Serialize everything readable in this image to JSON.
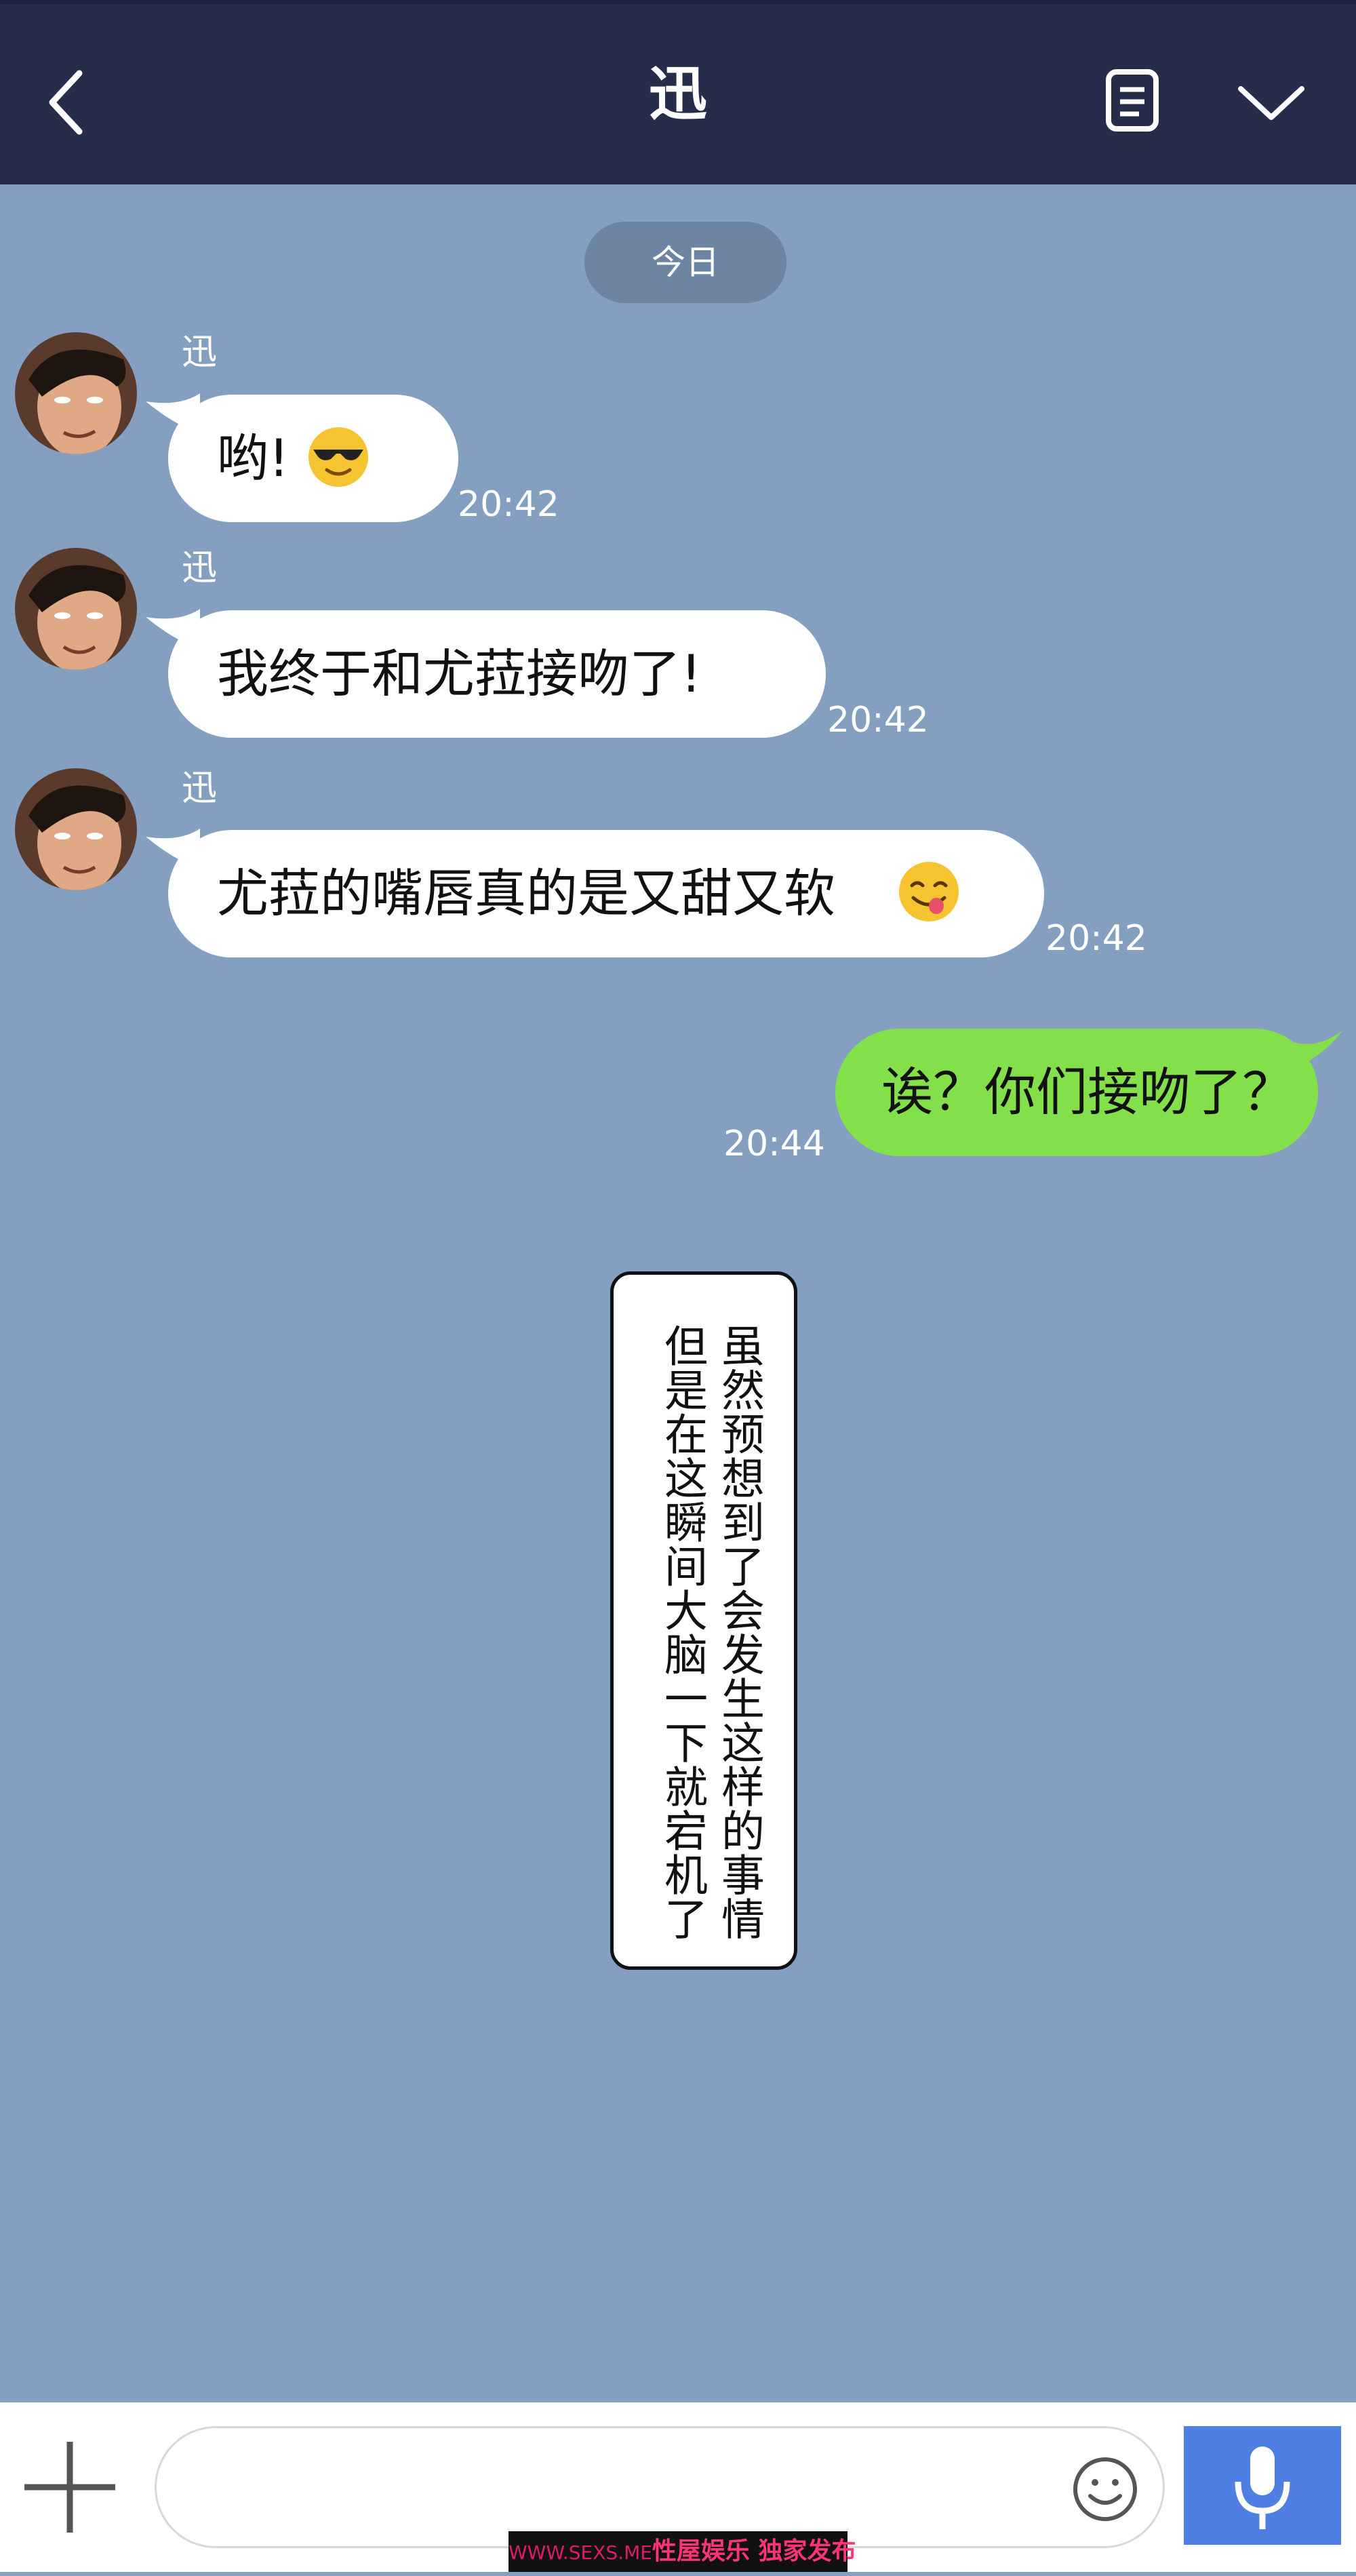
{
  "header": {
    "title": "迅"
  },
  "date_label": "今日",
  "messages": [
    {
      "sender": "迅",
      "text": "哟!",
      "emoji": "sunglasses-emoji",
      "time": "20:42"
    },
    {
      "sender": "迅",
      "text": "我终于和尤菈接吻了!",
      "time": "20:42"
    },
    {
      "sender": "迅",
      "text": "尤菈的嘴唇真的是又甜又软",
      "emoji": "yum-emoji",
      "time": "20:42"
    },
    {
      "sender": "me",
      "text": "诶？你们接吻了？",
      "time": "20:44"
    }
  ],
  "narration": {
    "line1": "虽然预想到了会发生这样的事情",
    "line2": "但是在这瞬间大脑一下就宕机了"
  },
  "input": {
    "value": ""
  },
  "watermark": {
    "site": "WWW.SEXS.ME",
    "text": "性屋娱乐 独家发布"
  },
  "colors": {
    "header_bg": "#252d4a",
    "chat_bg": "#849fc0",
    "incoming_bubble": "#ffffff",
    "outgoing_bubble": "#84e04a",
    "mic_button": "#4f7fe2"
  }
}
